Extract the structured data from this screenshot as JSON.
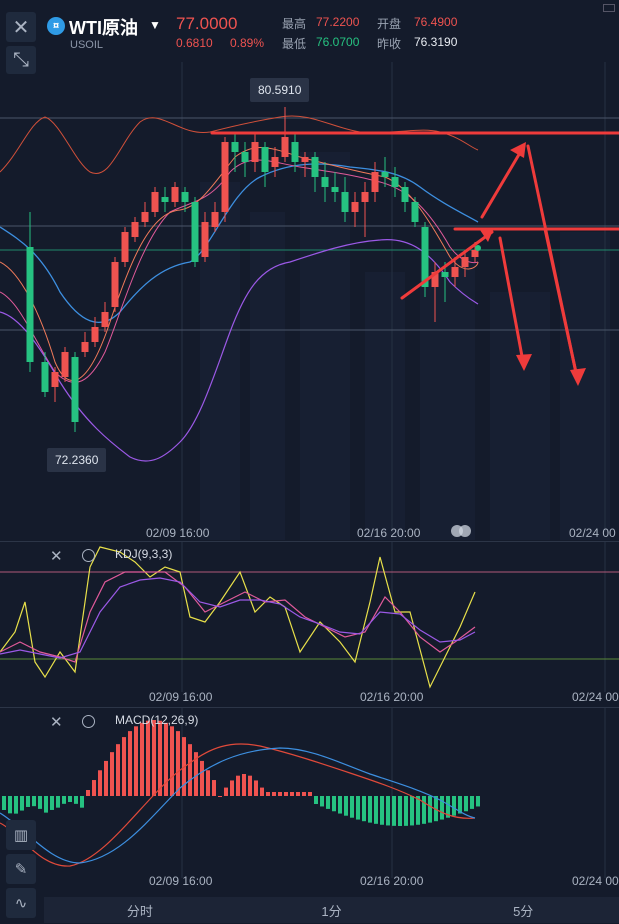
{
  "header": {
    "symbol": "WTI原油",
    "code": "USOIL",
    "price": "77.0000",
    "change": "0.6810",
    "change_pct": "0.89%",
    "high_label": "最高",
    "high_value": "77.2200",
    "open_label": "开盘",
    "open_value": "76.4900",
    "low_label": "最低",
    "low_value": "76.0700",
    "prev_label": "昨收",
    "prev_value": "76.3190"
  },
  "main_chart": {
    "max_tag": "80.5910",
    "min_tag": "72.2360",
    "x_ticks": [
      "02/09 16:00",
      "02/16 20:00",
      "02/24 00"
    ]
  },
  "kdj_pane": {
    "title": "KDJ(9,3,3)",
    "x_ticks": [
      "02/09 16:00",
      "02/16 20:00",
      "02/24 00"
    ]
  },
  "macd_pane": {
    "title": "MACD(12,26,9)",
    "x_ticks": [
      "02/09 16:00",
      "02/16 20:00",
      "02/24 00"
    ]
  },
  "tabs": [
    "分时",
    "1分",
    "5分"
  ],
  "colors": {
    "up": "#ef5350",
    "down": "#26c281",
    "bg": "#141b2b",
    "ma_blue": "#3d8fe0",
    "boll_purple": "#9b59e6"
  },
  "icons": [
    "close-icon",
    "expand-icon",
    "symbol-icon",
    "caret-down-icon",
    "settings-icon",
    "candles-icon",
    "pencil-icon",
    "wave-icon"
  ]
}
